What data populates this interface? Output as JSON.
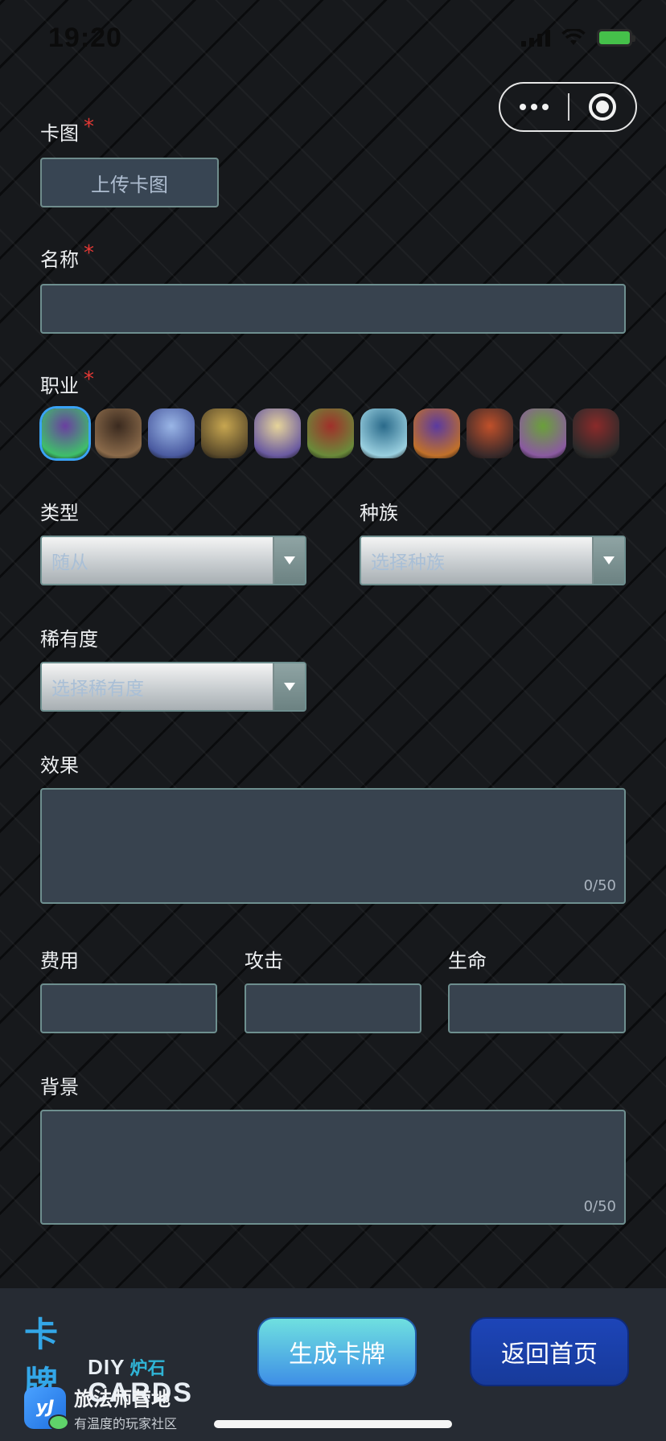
{
  "status_bar": {
    "time": "19:20"
  },
  "form": {
    "card_image": {
      "label": "卡图",
      "required_mark": "*",
      "upload_label": "上传卡图"
    },
    "name": {
      "label": "名称",
      "required_mark": "*",
      "value": ""
    },
    "class": {
      "label": "职业",
      "required_mark": "*",
      "icons": [
        {
          "icon": "druid-portrait-icon",
          "colors": [
            "#6a3fa0",
            "#3fbf6a"
          ]
        },
        {
          "icon": "warrior-portrait-icon",
          "colors": [
            "#3a2a1f",
            "#8a6a4a"
          ]
        },
        {
          "icon": "mage-portrait-icon",
          "colors": [
            "#9ab6e6",
            "#4a5aa0"
          ]
        },
        {
          "icon": "paladin-portrait-icon",
          "colors": [
            "#c7a650",
            "#5a4a2a"
          ]
        },
        {
          "icon": "priest-portrait-icon",
          "colors": [
            "#e6d49a",
            "#6a5aa0"
          ]
        },
        {
          "icon": "hunter-portrait-icon",
          "colors": [
            "#a0302a",
            "#6a8a3a"
          ]
        },
        {
          "icon": "shaman-portrait-icon",
          "colors": [
            "#2a6a8a",
            "#9ad0e0"
          ]
        },
        {
          "icon": "warlock-portrait-icon",
          "colors": [
            "#5a3aa0",
            "#c0702a"
          ]
        },
        {
          "icon": "rogue-portrait-icon",
          "colors": [
            "#c0502a",
            "#3a2a2a"
          ]
        },
        {
          "icon": "demon-hunter-portrait-icon",
          "colors": [
            "#6aa03a",
            "#8a5aa0"
          ]
        },
        {
          "icon": "neutral-portrait-icon",
          "colors": [
            "#8a2a2a",
            "#2a2a2a"
          ]
        }
      ],
      "selected_index": 0
    },
    "type": {
      "label": "类型",
      "value": "随从"
    },
    "race": {
      "label": "种族",
      "placeholder": "选择种族"
    },
    "rarity": {
      "label": "稀有度",
      "placeholder": "选择稀有度"
    },
    "effect": {
      "label": "效果",
      "value": "",
      "counter": "0/50"
    },
    "cost": {
      "label": "费用",
      "value": ""
    },
    "attack": {
      "label": "攻击",
      "value": ""
    },
    "health": {
      "label": "生命",
      "value": ""
    },
    "background": {
      "label": "背景",
      "value": "",
      "counter": "0/50"
    }
  },
  "footer": {
    "logo": {
      "main": "卡牌",
      "diy": "DIY",
      "hearthstone": "炉石",
      "cards": "CARDS"
    },
    "brand": {
      "icon_text": "yJ",
      "name": "旅法师营地",
      "slogan": "有温度的玩家社区"
    },
    "generate_label": "生成卡牌",
    "home_label": "返回首页"
  },
  "colors": {
    "accent": "#3aa3f5",
    "required": "#e53935",
    "field_bg": "#38434f",
    "field_border": "#6e8f8f",
    "generate_button": "#4ab6e6",
    "home_button": "#1d45b8"
  }
}
